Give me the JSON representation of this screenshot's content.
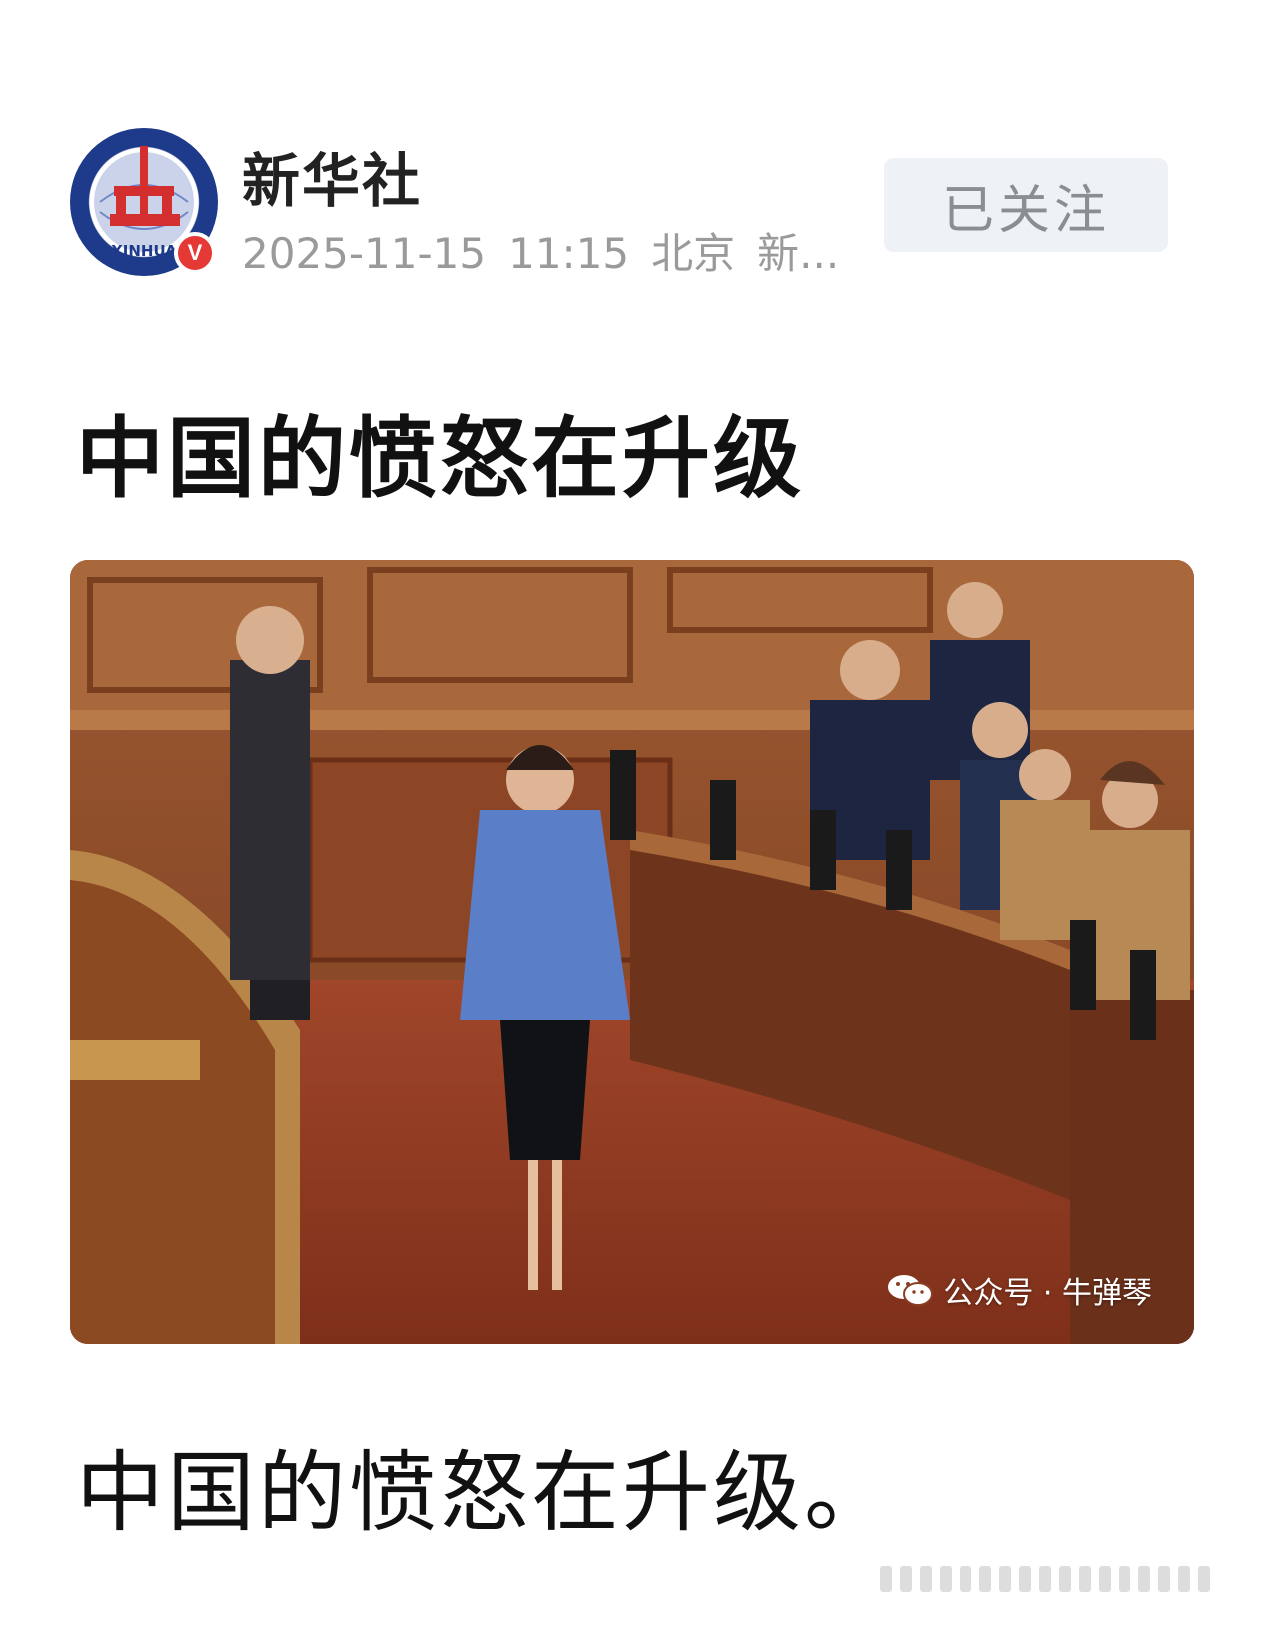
{
  "account": {
    "name": "新华社",
    "avatar_text": "XINHUA",
    "verified_badge": "V",
    "date": "2025-11-15",
    "time": "11:15",
    "location": "北京",
    "source": "新..."
  },
  "follow_button": {
    "label": "已关注"
  },
  "article": {
    "title": "中国的愤怒在升级",
    "body": "中国的愤怒在升级。"
  },
  "photo": {
    "watermark": "公众号 · 牛弹琴"
  },
  "colors": {
    "brand_blue": "#1e3a8a",
    "brand_red": "#e53935",
    "muted_text": "#9a9a9a",
    "button_bg": "#eef1f5"
  }
}
